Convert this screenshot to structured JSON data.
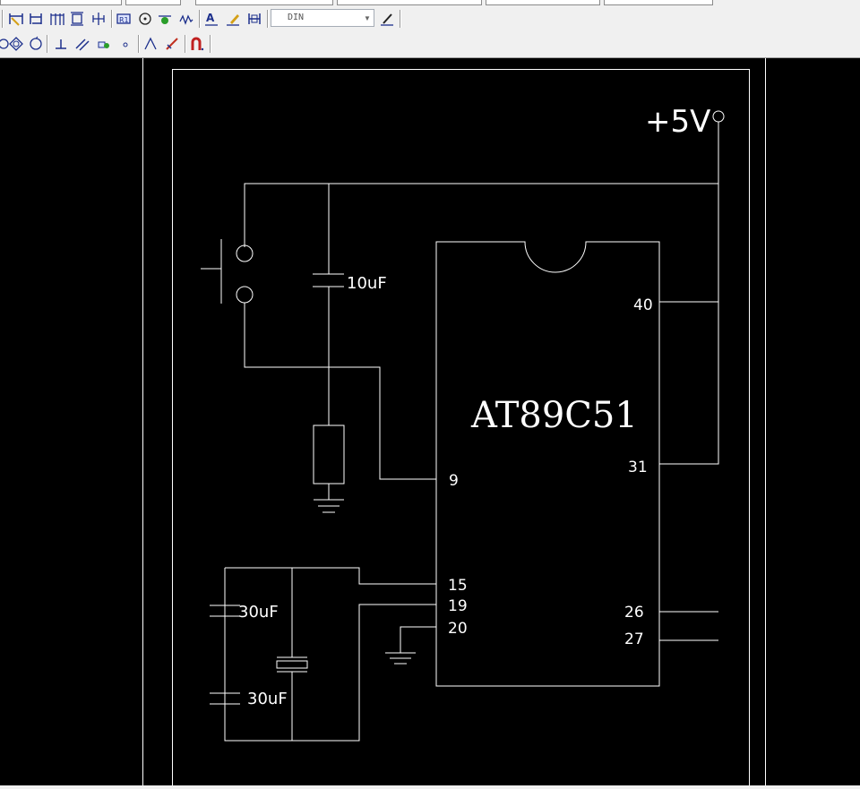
{
  "toolbar": {
    "dimension_style": {
      "selected": "DIN"
    },
    "row1_icons": [
      "linear-dimension-icon",
      "aligned-dimension-icon",
      "baseline-dimension-icon",
      "continue-dimension-icon",
      "ordinate-dimension-icon",
      "radius-dimension-icon",
      "diameter-dimension-icon",
      "angular-dimension-icon",
      "arc-length-icon",
      "dimension-edit-icon",
      "dimension-text-edit-icon",
      "dimension-update-icon",
      "dimension-style-icon"
    ],
    "row2_icons": [
      "tangent-snap-icon",
      "center-snap-icon",
      "node-snap-icon",
      "perpendicular-snap-icon",
      "parallel-snap-icon",
      "insert-snap-icon",
      "nearest-snap-icon",
      "snap-none-icon",
      "snap-settings-icon",
      "magnet-icon"
    ]
  },
  "drawing": {
    "supply_label": "+5V",
    "chip_name": "AT89C51",
    "capacitors": {
      "reset": "10uF",
      "xtal_top": "30uF",
      "xtal_bottom": "30uF"
    },
    "pins": {
      "p40": "40",
      "p31": "31",
      "p9": "9",
      "p15": "15",
      "p19": "19",
      "p20": "20",
      "p26": "26",
      "p27": "27"
    }
  }
}
